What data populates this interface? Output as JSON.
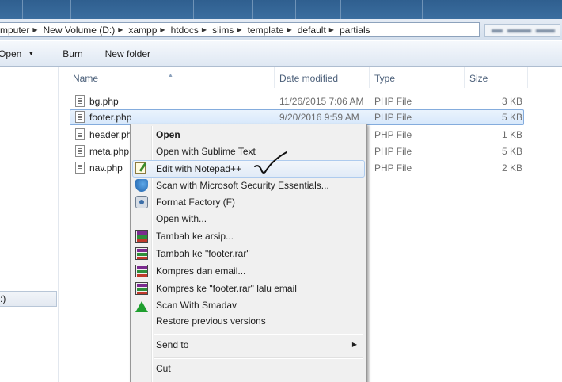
{
  "breadcrumb": [
    "mputer",
    "New Volume (D:)",
    "xampp",
    "htdocs",
    "slims",
    "template",
    "default",
    "partials"
  ],
  "toolbar": {
    "open_label": "Open",
    "burn_label": "Burn",
    "newfolder_label": "New folder"
  },
  "nav": {
    "drive_label": ":)"
  },
  "columns": {
    "name": "Name",
    "date": "Date modified",
    "type": "Type",
    "size": "Size"
  },
  "files": [
    {
      "name": "bg.php",
      "date": "11/26/2015 7:06 AM",
      "type": "PHP File",
      "size": "3 KB"
    },
    {
      "name": "footer.php",
      "date": "9/20/2016 9:59 AM",
      "type": "PHP File",
      "size": "5 KB",
      "selected": true
    },
    {
      "name": "header.ph",
      "date": "",
      "type": "PHP File",
      "size": "1 KB"
    },
    {
      "name": "meta.php",
      "date": "",
      "type": "PHP File",
      "size": "5 KB"
    },
    {
      "name": "nav.php",
      "date": "",
      "type": "PHP File",
      "size": "2 KB"
    }
  ],
  "context_menu": {
    "open": "Open",
    "sublime": "Open with Sublime Text",
    "notepad": "Edit with Notepad++",
    "mse": "Scan with Microsoft Security Essentials...",
    "format_factory": "Format Factory (F)",
    "open_with": "Open with...",
    "tambah_arsip": "Tambah ke arsip...",
    "tambah_footer": "Tambah ke \"footer.rar\"",
    "kompres_email": "Kompres dan email...",
    "kompres_footer_email": "Kompres ke \"footer.rar\" lalu email",
    "smadav": "Scan With Smadav",
    "restore": "Restore previous versions",
    "send_to": "Send to",
    "cut": "Cut"
  },
  "icons": {
    "file": "php-file-icon",
    "notepad": "notepad-plus-plus-icon",
    "mse": "security-essentials-icon",
    "format_factory": "format-factory-icon",
    "winrar": "winrar-icon",
    "smadav": "smadav-icon"
  }
}
